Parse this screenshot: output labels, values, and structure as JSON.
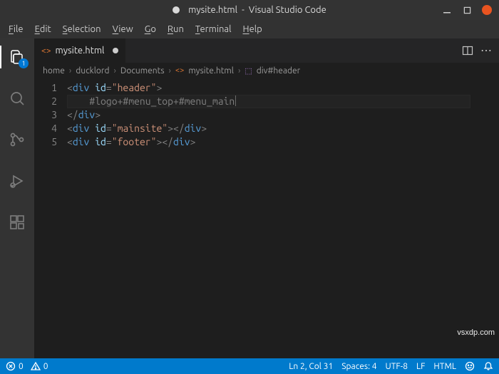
{
  "titlebar": {
    "dirty": true,
    "filename": "mysite.html",
    "app": "Visual Studio Code"
  },
  "menubar": {
    "items": [
      "File",
      "Edit",
      "Selection",
      "View",
      "Go",
      "Run",
      "Terminal",
      "Help"
    ]
  },
  "activitybar": {
    "explorer_badge": "1"
  },
  "tabs": {
    "active": {
      "icon": "<>",
      "label": "mysite.html",
      "dirty": true
    }
  },
  "breadcrumb": {
    "segments": [
      "home",
      "ducklord",
      "Documents"
    ],
    "file": "mysite.html",
    "symbol": "div#header"
  },
  "editor": {
    "line_numbers": [
      "1",
      "2",
      "3",
      "4",
      "5"
    ],
    "lines": {
      "l1": {
        "open_br": "<",
        "tag": "div",
        "sp": " ",
        "attr": "id",
        "eq": "=",
        "val": "\"header\"",
        "close_br": ">"
      },
      "l2": {
        "indent": "    ",
        "text": "#logo+#menu_top+#menu_main"
      },
      "l3": {
        "open_br": "</",
        "tag": "div",
        "close_br": ">"
      },
      "l4": {
        "open_br": "<",
        "tag": "div",
        "sp": " ",
        "attr": "id",
        "eq": "=",
        "val": "\"mainsite\"",
        "close_br": ">",
        "open2_br": "</",
        "tag2": "div",
        "close2_br": ">"
      },
      "l5": {
        "open_br": "<",
        "tag": "div",
        "sp": " ",
        "attr": "id",
        "eq": "=",
        "val": "\"footer\"",
        "close_br": ">",
        "open2_br": "</",
        "tag2": "div",
        "close2_br": ">"
      }
    },
    "current_line_index": 1
  },
  "statusbar": {
    "errors": "0",
    "warnings": "0",
    "ln_col": "Ln 2, Col 31",
    "spaces": "Spaces: 4",
    "encoding": "UTF-8",
    "eol": "LF",
    "language": "HTML",
    "feedback": ""
  },
  "watermark": "vsxdp.com"
}
